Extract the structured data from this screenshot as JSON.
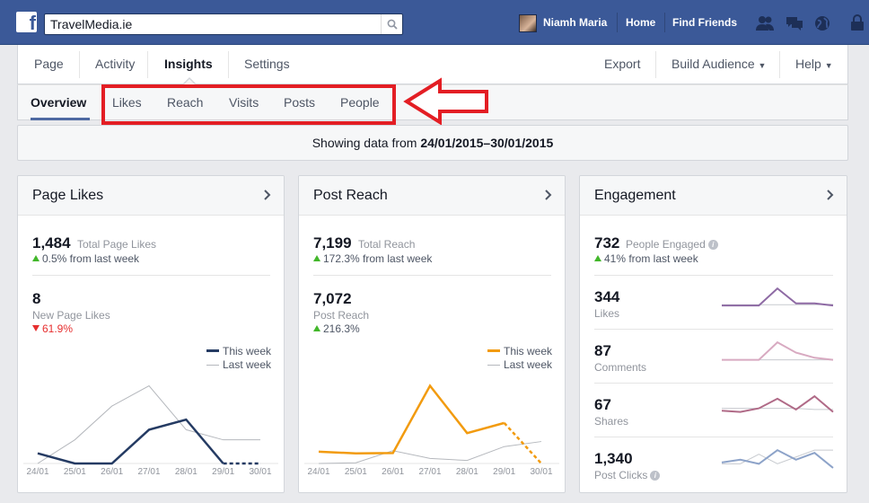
{
  "topbar": {
    "logo": "f",
    "search_value": "TravelMedia.ie",
    "user_name": "Niamh Maria",
    "home": "Home",
    "find_friends": "Find Friends",
    "icons": [
      "friend-requests-icon",
      "messages-icon",
      "notifications-globe-icon",
      "privacy-lock-icon"
    ]
  },
  "page_nav": {
    "left": [
      "Page",
      "Activity",
      "Insights",
      "Settings"
    ],
    "export": "Export",
    "build_audience": "Build Audience",
    "help": "Help"
  },
  "sub_nav": [
    "Overview",
    "Likes",
    "Reach",
    "Visits",
    "Posts",
    "People"
  ],
  "date_range": {
    "prefix": "Showing data from ",
    "range": "24/01/2015–30/01/2015"
  },
  "cards": {
    "likes": {
      "title": "Page Likes",
      "total": "1,484",
      "total_label": "Total Page Likes",
      "total_delta": "0.5% from last week",
      "new": "8",
      "new_label": "New Page Likes",
      "new_delta": "61.9%",
      "legend": [
        "This week",
        "Last week"
      ]
    },
    "reach": {
      "title": "Post Reach",
      "total": "7,199",
      "total_label": "Total Reach",
      "total_delta": "172.3% from last week",
      "post": "7,072",
      "post_label": "Post Reach",
      "post_delta": "216.3%",
      "legend": [
        "This week",
        "Last week"
      ]
    },
    "engagement": {
      "title": "Engagement",
      "total": "732",
      "total_label": "People Engaged",
      "total_delta": "41% from last week",
      "rows": [
        {
          "value": "344",
          "label": "Likes"
        },
        {
          "value": "87",
          "label": "Comments"
        },
        {
          "value": "67",
          "label": "Shares"
        },
        {
          "value": "1,340",
          "label": "Post Clicks"
        }
      ]
    }
  },
  "colors": {
    "topbar": "#3b5998",
    "likes_this_week": "#253b63",
    "reach_this_week": "#f29b0f",
    "last_week": "#b5b8bd",
    "up": "#42b72a",
    "down": "#e62e2e",
    "annotation": "#e31e24"
  },
  "chart_data": [
    {
      "type": "line",
      "x": [
        "24/01",
        "25/01",
        "26/01",
        "27/01",
        "28/01",
        "29/01",
        "30/01"
      ],
      "ylim": [
        0,
        25
      ],
      "series": [
        {
          "name": "This week",
          "values": [
            3,
            0,
            0,
            10,
            13,
            0,
            0
          ]
        },
        {
          "name": "Last week",
          "values": [
            0,
            7,
            17,
            23,
            10,
            7,
            7
          ]
        }
      ]
    },
    {
      "type": "line",
      "x": [
        "24/01",
        "25/01",
        "26/01",
        "27/01",
        "28/01",
        "29/01",
        "30/01"
      ],
      "ylim": [
        0,
        2500
      ],
      "series": [
        {
          "name": "This week",
          "values": [
            350,
            300,
            310,
            2300,
            900,
            1200,
            0
          ]
        },
        {
          "name": "Last week",
          "values": [
            0,
            20,
            380,
            150,
            90,
            500,
            650
          ]
        }
      ]
    },
    {
      "type": "line",
      "x": [
        "24/01",
        "25/01",
        "26/01",
        "27/01",
        "28/01",
        "29/01",
        "30/01"
      ],
      "series": [
        {
          "name": "Likes",
          "values": [
            16,
            16,
            16,
            95,
            26,
            26,
            16
          ]
        },
        {
          "name": "Comments",
          "values": [
            3,
            3,
            3,
            20,
            10,
            5,
            3
          ]
        }
      ]
    }
  ]
}
